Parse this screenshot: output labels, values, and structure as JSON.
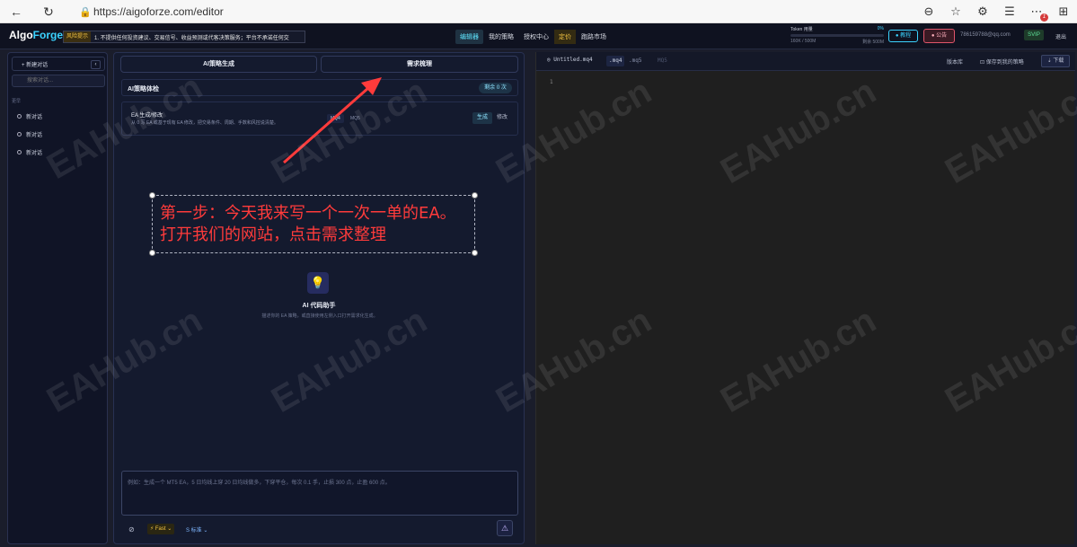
{
  "browser": {
    "url": "https://aigoforze.com/editor",
    "notification_count": "1"
  },
  "header": {
    "logo_left": "Algo",
    "logo_right": "Forge",
    "risk_tag": "风险提示",
    "risk_text": "1. 不提供任何投资建议、交易信号、收益预测或代客决策服务；平台不承诺任何交",
    "nav": [
      "编辑器",
      "我的策略",
      "授权中心",
      "定价",
      "跑路市场"
    ],
    "token_label": "Token 用量",
    "token_pct": "0%",
    "token_used": "160K / 500M",
    "token_left": "剩余 500M",
    "tutorial_btn": "● 教程",
    "notice_btn": "● 公告",
    "email": "786159788@qq.com",
    "svip": "SVIP",
    "logout": "退出"
  },
  "sidebar": {
    "new_chat": "+ 新建对话",
    "collapse": "‹",
    "search_placeholder": "搜索对话...",
    "section_label": "更早",
    "items": [
      "新对话",
      "新对话",
      "新对话"
    ]
  },
  "middle": {
    "tab_generate": "AI策略生成",
    "tab_requirements": "需求梳理",
    "quota_title": "AI策略体检",
    "quota_value": "剩余 0 次",
    "ea_title": "EA 生成/修改",
    "ea_desc": "从 0 写 EA 或基于现有 EA 修改，把交易条件、周期、手数和风控说清楚。",
    "ea_mq4": "MQ4",
    "ea_mq5": "MQ5",
    "ea_generate": "生成",
    "ea_modify": "修改",
    "annotation_line1": "第一步：今天我来写一个一次一单的EA。",
    "annotation_line2": "打开我们的网站，点击需求整理",
    "assistant_icon": "💡",
    "assistant_title": "AI 代码助手",
    "assistant_desc": "描述你的 EA 策略，或直接使用左侧入口打开需求化生成。",
    "prompt_placeholder": "例如：生成一个 MT5 EA，5 日均线上穿 20 日均线做多，下穿平仓，每次 0.1 手，止损 300 点，止盈 600 点。",
    "fast_label": "⚡ Fast ⌄",
    "standard_label": "S 标准 ⌄",
    "attach_icon": "⊘",
    "send_icon": "⚠"
  },
  "editor": {
    "file_name": "Untitled.mq4",
    "ext_mq4": ".mq4",
    "ext_mq5": ".mq5",
    "mq_label": "MQ5",
    "version_lib": "版本库",
    "save_label": "保存到我的策略",
    "download_label": "⇣ 下载",
    "line_1": "1"
  },
  "watermark": "EAHub.cn"
}
